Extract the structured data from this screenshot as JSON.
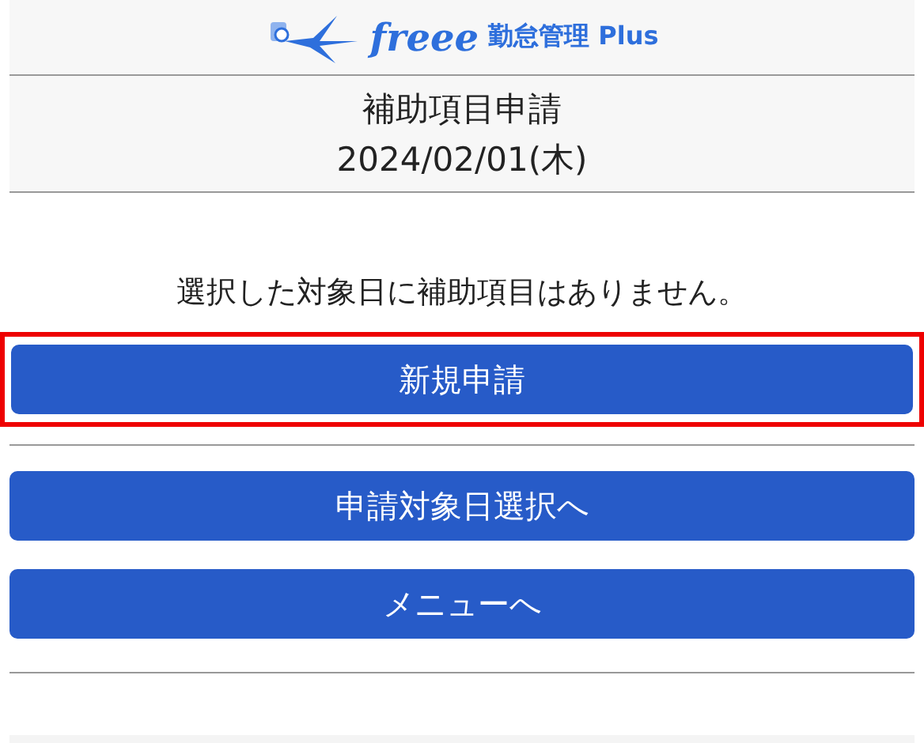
{
  "header": {
    "brand": "freee",
    "product": "勤怠管理 Plus"
  },
  "title": {
    "heading": "補助項目申請",
    "date": "2024/02/01(木)"
  },
  "message": "選択した対象日に補助項目はありません。",
  "primary_buttons": [
    {
      "label": "新規申請",
      "highlighted": true
    }
  ],
  "nav_buttons": [
    {
      "label": "申請対象日選択へ",
      "highlighted": false
    },
    {
      "label": "メニューへ",
      "highlighted": false
    }
  ]
}
